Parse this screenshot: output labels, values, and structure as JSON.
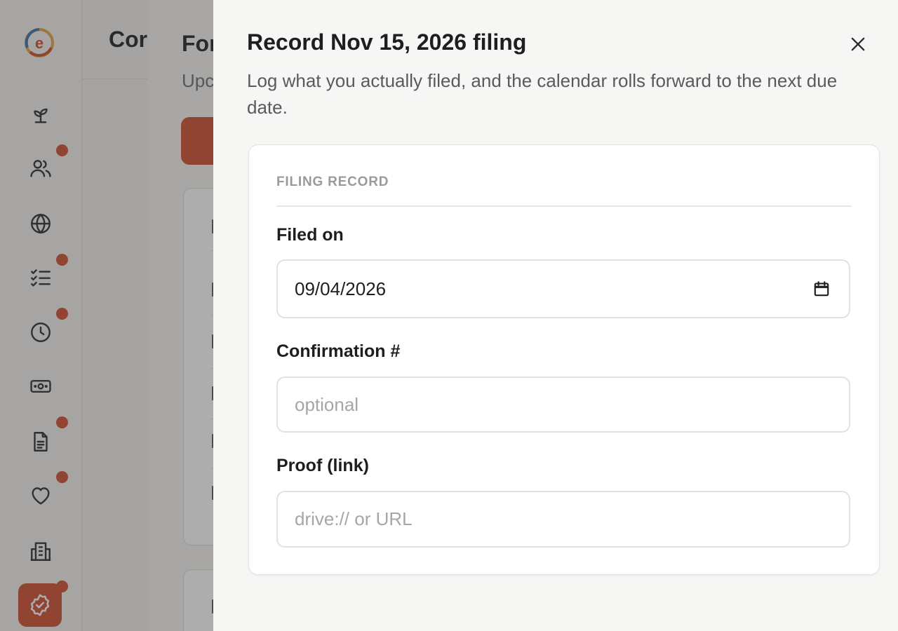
{
  "background": {
    "page_title": "Cor",
    "panel_title": "For",
    "panel_subtitle": "Upc"
  },
  "drawer": {
    "title": "Record Nov 15, 2026 filing",
    "subtitle": "Log what you actually filed, and the calendar rolls forward to the next due date.",
    "section_label": "FILING RECORD",
    "fields": {
      "filed_on": {
        "label": "Filed on",
        "value": "09/04/2026"
      },
      "confirmation": {
        "label": "Confirmation #",
        "placeholder": "optional"
      },
      "proof": {
        "label": "Proof (link)",
        "placeholder": "drive:// or URL"
      }
    }
  },
  "sidebar": {
    "icons": [
      "sprout-icon",
      "users-icon",
      "globe-icon",
      "checklist-icon",
      "clock-icon",
      "money-icon",
      "document-icon",
      "heart-icon",
      "building-icon",
      "badge-check-icon"
    ]
  },
  "colors": {
    "accent": "#cf4b2c",
    "overlay": "rgba(60,60,60,0.42)"
  }
}
